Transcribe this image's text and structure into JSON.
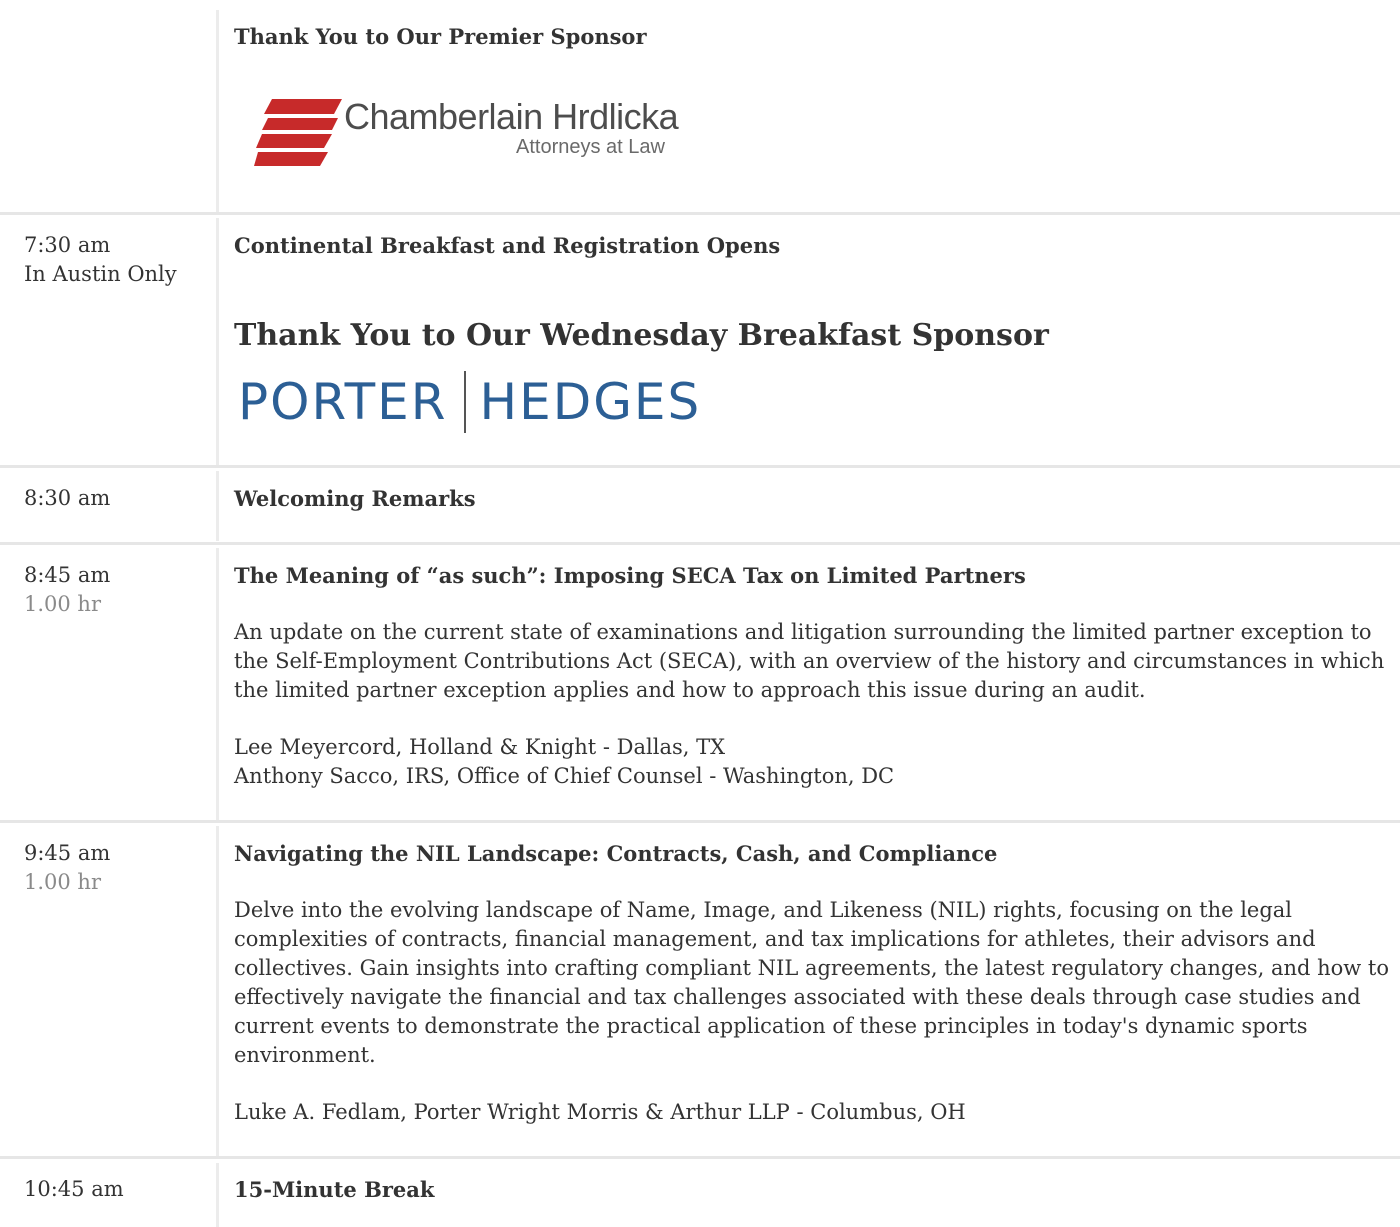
{
  "premier_sponsor": {
    "heading": "Thank You to Our Premier Sponsor",
    "logo_name": "Chamberlain Hrdlicka",
    "logo_sub": "Attorneys at Law",
    "logo_color": "#c72a2a"
  },
  "sessions": [
    {
      "time": "7:30 am",
      "note": "In Austin Only",
      "title": "Continental Breakfast and Registration Opens",
      "sponsor_heading": "Thank You to Our Wednesday Breakfast Sponsor",
      "sponsor_logo_left": "PORTER",
      "sponsor_logo_right": "HEDGES",
      "sponsor_logo_color": "#2c5f95"
    },
    {
      "time": "8:30 am",
      "title": "Welcoming Remarks"
    },
    {
      "time": "8:45 am",
      "duration": "1.00 hr",
      "title": "The Meaning of “as such”: Imposing SECA Tax on Limited Partners",
      "description": "An update on the current state of examinations and litigation surrounding the limited partner exception to the Self-Employment Contributions Act (SECA), with  an overview of the history and circumstances in which the limited partner exception applies and how to approach this issue during an audit.",
      "speakers": [
        "Lee Meyercord, Holland & Knight - Dallas, TX",
        "Anthony Sacco, IRS, Office of Chief Counsel - Washington, DC"
      ]
    },
    {
      "time": "9:45 am",
      "duration": "1.00 hr",
      "title": "Navigating the NIL Landscape: Contracts, Cash, and Compliance",
      "description": "Delve into the evolving landscape of Name, Image, and Likeness (NIL) rights, focusing on the legal complexities of contracts, financial management, and tax implications for athletes, their advisors and collectives. Gain insights into crafting compliant NIL agreements, the latest regulatory changes, and how to effectively navigate the financial and tax challenges associated with these deals through case studies and current events to demonstrate the practical application of these principles in today's dynamic sports environment.",
      "speakers": [
        "Luke A. Fedlam, Porter Wright Morris & Arthur LLP - Columbus, OH"
      ]
    },
    {
      "time": "10:45 am",
      "title": "15-Minute Break"
    }
  ]
}
